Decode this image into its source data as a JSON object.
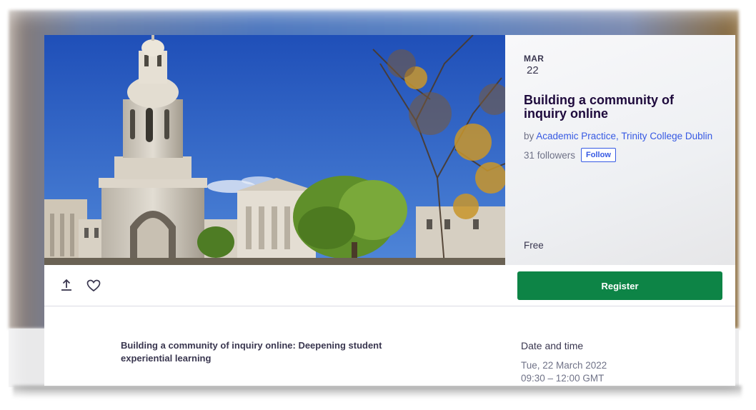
{
  "event": {
    "month": "MAR",
    "day": "22",
    "title": "Building a community of inquiry online",
    "organizer_prefix": "by ",
    "organizer_name": "Academic Practice, Trinity College Dublin",
    "followers": "31 followers",
    "follow_label": "Follow",
    "price": "Free"
  },
  "actions": {
    "share_icon": "share-icon",
    "like_icon": "heart-icon",
    "register_label": "Register"
  },
  "details": {
    "description_title": "Building a community of inquiry online: Deepening student experiential learning",
    "date_heading": "Date and time",
    "date": "Tue, 22 March 2022",
    "time": "09:30 – 12:00 GMT"
  },
  "colors": {
    "accent_link": "#3659e3",
    "register_green": "#0d8446",
    "title_dark": "#1e0a3c"
  }
}
